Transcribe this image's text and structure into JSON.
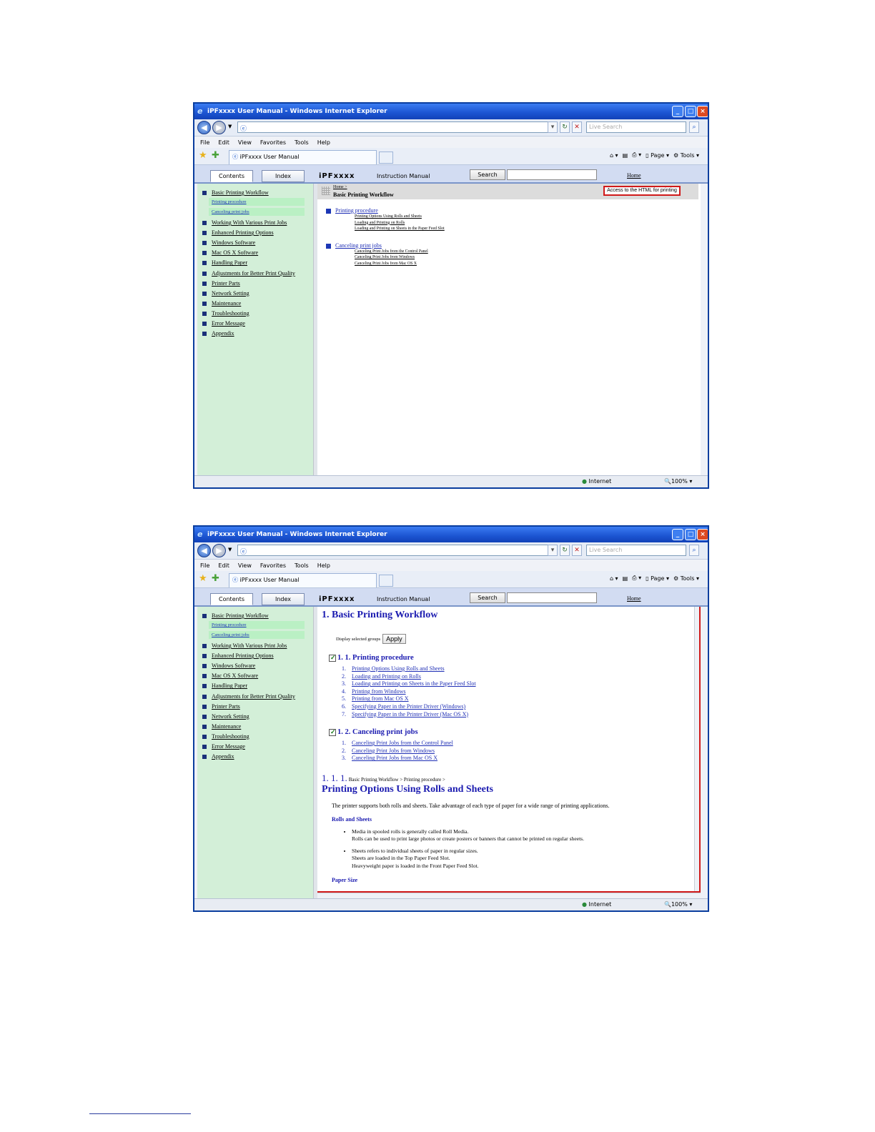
{
  "browser": {
    "title": "iPFxxxx User Manual - Windows Internet Explorer",
    "search_placeholder": "Live Search",
    "menu": [
      "File",
      "Edit",
      "View",
      "Favorites",
      "Tools",
      "Help"
    ],
    "tab_label": "iPFxxxx User Manual",
    "page_label": "Page",
    "tools_label": "Tools",
    "status_zone": "Internet",
    "zoom": "100%"
  },
  "app": {
    "contents_tab": "Contents",
    "index_tab": "Index",
    "brand": "iPFxxxx",
    "instruction_manual": "Instruction Manual",
    "search_button": "Search",
    "home_link": "Home"
  },
  "sidebar": {
    "items": [
      "Basic Printing Workflow",
      "Printing procedure",
      "Canceling print jobs",
      "Working With Various Print Jobs",
      "Enhanced Printing Options",
      "Windows Software",
      "Mac OS X Software",
      "Handling Paper",
      "Adjustments for Better Print Quality",
      "Printer Parts",
      "Network Setting",
      "Maintenance",
      "Troubleshooting",
      "Error Message",
      "Appendix"
    ]
  },
  "screen1": {
    "breadcrumb_home": "Home >",
    "title": "Basic Printing Workflow",
    "html_print_link": "Access to the HTML for printing",
    "sections": [
      {
        "title": "Printing procedure",
        "items": [
          "Printing Options Using Rolls and Sheets",
          "Loading and Printing on Rolls",
          "Loading and Printing on Sheets in the Paper Feed Slot"
        ]
      },
      {
        "title": "Canceling print jobs",
        "items": [
          "Canceling Print Jobs from the Control Panel",
          "Canceling Print Jobs from Windows",
          "Canceling Print Jobs from Mac OS X"
        ]
      }
    ]
  },
  "screen2": {
    "heading": "1. Basic Printing Workflow",
    "display_selected": "Display selected groups",
    "apply": "Apply",
    "group1_title": "1. 1. Printing procedure",
    "group1_items": [
      "Printing Options Using Rolls and Sheets",
      "Loading and Printing on Rolls",
      "Loading and Printing on Sheets in the Paper Feed Slot",
      "Printing from Windows",
      "Printing from Mac OS X",
      "Specifying Paper in the Printer Driver (Windows)",
      "Specifying Paper in the Printer Driver (Mac OS X)"
    ],
    "group2_title": "1. 2. Canceling print jobs",
    "group2_items": [
      "Canceling Print Jobs from the Control Panel",
      "Canceling Print Jobs from Windows",
      "Canceling Print Jobs from Mac OS X"
    ],
    "sec_num": "1. 1. 1.",
    "sec_breadcrumb": "Basic Printing Workflow > Printing procedure >",
    "sec_title": "Printing Options Using Rolls and Sheets",
    "intro": "The printer supports both rolls and sheets. Take advantage of each type of paper for a wide range of printing applications.",
    "rolls_heading": "Rolls and Sheets",
    "bullet1_a": "Media in spooled rolls is generally called Roll Media.",
    "bullet1_b": "Rolls can be used to print large photos or create posters or banners that cannot be printed on regular sheets.",
    "bullet2_a": "Sheets refers to individual sheets of paper in regular sizes.",
    "bullet2_b": "Sheets are loaded in the Top Paper Feed Slot.",
    "bullet2_c": "Heavyweight paper is loaded in the Front Paper Feed Slot.",
    "paper_size": "Paper Size"
  }
}
